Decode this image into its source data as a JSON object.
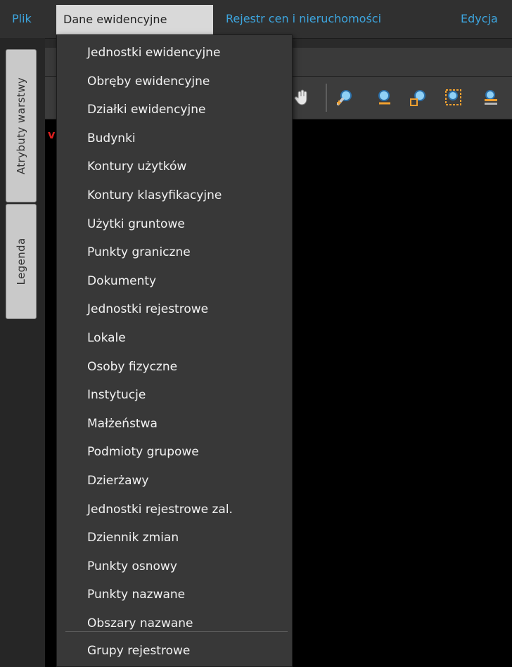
{
  "menubar": {
    "items": [
      {
        "label": "Plik"
      },
      {
        "label": "Dane ewidencyjne"
      },
      {
        "label": "Rejestr cen i nieruchomości"
      },
      {
        "label": "Edycja"
      }
    ]
  },
  "side_tabs": {
    "attributes": "Atrybuty warstwy",
    "legend": "Legenda"
  },
  "map": {
    "marker": "v"
  },
  "dropdown": {
    "items": [
      {
        "label": "Jednostki ewidencyjne"
      },
      {
        "label": "Obręby ewidencyjne"
      },
      {
        "label": "Działki ewidencyjne"
      },
      {
        "label": "Budynki"
      },
      {
        "label": "Kontury użytków"
      },
      {
        "label": "Kontury klasyfikacyjne"
      },
      {
        "label": "Użytki gruntowe"
      },
      {
        "label": "Punkty graniczne"
      },
      {
        "label": "Dokumenty"
      },
      {
        "label": "Jednostki rejestrowe"
      },
      {
        "label": "Lokale"
      },
      {
        "label": "Osoby fizyczne"
      },
      {
        "label": "Instytucje"
      },
      {
        "label": "Małżeństwa"
      },
      {
        "label": "Podmioty grupowe"
      },
      {
        "label": "Dzierżawy"
      },
      {
        "label": "Jednostki rejestrowe zal."
      },
      {
        "label": "Dziennik zmian"
      },
      {
        "label": "Punkty osnowy"
      },
      {
        "label": "Punkty nazwane"
      },
      {
        "label": "Obszary nazwane"
      }
    ],
    "extra_item": {
      "label": "Grupy rejestrowe"
    }
  },
  "toolbar": {
    "icons": [
      "pan-hand-icon",
      "zoom-in-icon",
      "zoom-icon",
      "zoom-out-icon",
      "zoom-window-icon",
      "layers-icon"
    ]
  },
  "colors": {
    "menu_link": "#3da5de",
    "menu_active_bg": "#d9d9d9",
    "dropdown_bg": "#383838",
    "dropdown_text": "#f2f2f2"
  }
}
